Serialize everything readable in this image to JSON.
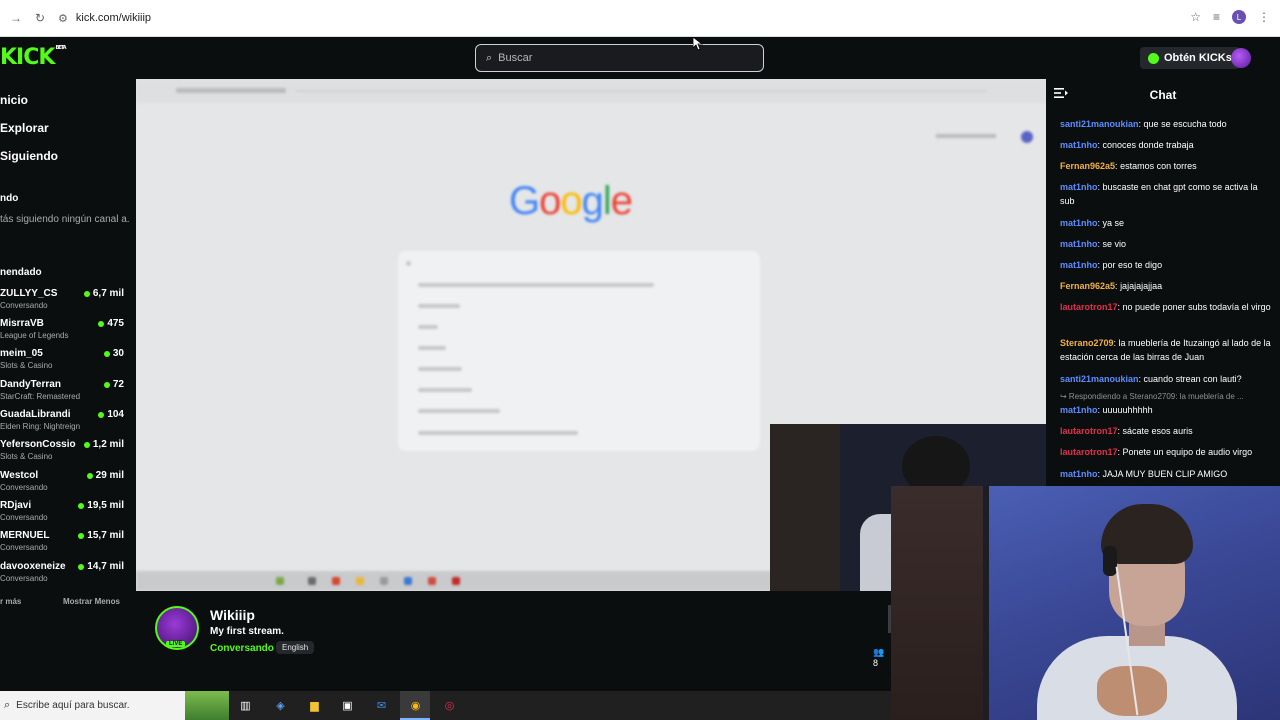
{
  "browser": {
    "url": "kick.com/wikiiip",
    "profile_initial": "L"
  },
  "header": {
    "search_placeholder": "Buscar",
    "get_kicks_label": "Obtén KICKs"
  },
  "sidebar": {
    "nav": [
      "nicio",
      "Explorar",
      "Siguiendo"
    ],
    "following_heading": "ndo",
    "following_note": "tás siguiendo ningún canal a.",
    "recommended_heading": "nendado",
    "channels": [
      {
        "name": "ZULLYY_CS",
        "category": "Conversando",
        "viewers": "6,7 mil"
      },
      {
        "name": "MisrraVB",
        "category": "League of Legends",
        "viewers": "475"
      },
      {
        "name": "meim_05",
        "category": "Slots & Casino",
        "viewers": "30"
      },
      {
        "name": "DandyTerran",
        "category": "StarCraft: Remastered",
        "viewers": "72"
      },
      {
        "name": "GuadaLibrandi",
        "category": "Elden Ring: Nightreign",
        "viewers": "104"
      },
      {
        "name": "YefersonCossio",
        "category": "Slots & Casino",
        "viewers": "1,2 mil"
      },
      {
        "name": "Westcol",
        "category": "Conversando",
        "viewers": "29 mil"
      },
      {
        "name": "RDjavi",
        "category": "Conversando",
        "viewers": "19,5 mil"
      },
      {
        "name": "MERNUEL",
        "category": "Conversando",
        "viewers": "15,7 mil"
      },
      {
        "name": "davooxeneize",
        "category": "Conversando",
        "viewers": "14,7 mil"
      }
    ],
    "show_more": "r más",
    "show_less": "Mostrar Menos"
  },
  "stream_screen": {
    "logo_letters": [
      "G",
      "o",
      "o",
      "g",
      "l",
      "e"
    ]
  },
  "chat": {
    "title": "Chat",
    "messages": [
      {
        "user": "santi21manoukian",
        "color": "#5b8dff",
        "text": "que se escucha todo"
      },
      {
        "user": "mat1nho",
        "color": "#5b8dff",
        "text": "conoces donde trabaja"
      },
      {
        "user": "Fernan962a5",
        "color": "#f2b143",
        "text": "estamos con torres"
      },
      {
        "user": "mat1nho",
        "color": "#5b8dff",
        "text": "buscaste en chat gpt como se activa la sub"
      },
      {
        "user": "mat1nho",
        "color": "#5b8dff",
        "text": "ya se"
      },
      {
        "user": "mat1nho",
        "color": "#5b8dff",
        "text": "se vio"
      },
      {
        "user": "mat1nho",
        "color": "#5b8dff",
        "text": "por eso te digo"
      },
      {
        "user": "Fernan962a5",
        "color": "#f2b143",
        "text": "jajajajajjaa"
      },
      {
        "user": "lautarotron17",
        "color": "#e0314b",
        "text": "no puede poner subs todavía el virgo"
      },
      {
        "user": "Sterano2709",
        "color": "#f2b143",
        "text": "la mueblería de Ituzaingó al lado de la estación cerca de las birras de Juan"
      },
      {
        "user": "santi21manoukian",
        "color": "#5b8dff",
        "text": "cuando strean con lauti?"
      },
      {
        "user": "mat1nho",
        "color": "#5b8dff",
        "text": "uuuuuhhhhh"
      },
      {
        "user": "lautarotron17",
        "color": "#e0314b",
        "text": "sácate esos auris"
      },
      {
        "user": "lautarotron17",
        "color": "#e0314b",
        "text": "Ponete un equipo de audio virgo"
      },
      {
        "user": "mat1nho",
        "color": "#5b8dff",
        "text": "JAJA MUY BUEN CLIP AMIGO"
      }
    ],
    "reply_note": "↪ Respondiendo a Sterano2709: la mueblería de ..."
  },
  "channel_info": {
    "name": "Wikiiip",
    "stream_title": "My first stream.",
    "category": "Conversando",
    "language": "English",
    "live_badge": "LIVE",
    "viewers_partial": "8"
  },
  "taskbar": {
    "search_placeholder": "Escribe aquí para buscar."
  },
  "colors": {
    "kick_green": "#53fc18",
    "background": "#0b0e0f"
  }
}
